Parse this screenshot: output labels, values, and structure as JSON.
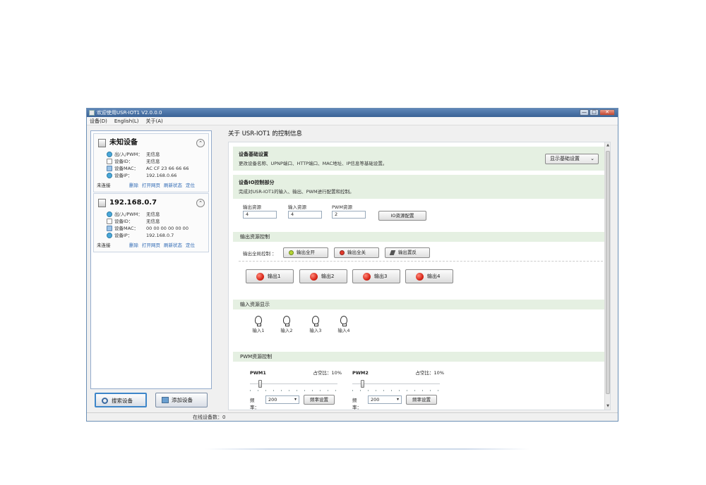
{
  "window": {
    "title": "欢迎使用USR-IOT1 V2.0.0.0",
    "menu": [
      "设备(D)",
      "English(L)",
      "关于(A)"
    ],
    "controls": {
      "minimize": "—",
      "maximize": "□",
      "close": "✕"
    }
  },
  "devices": [
    {
      "name": "未知设备",
      "rows": [
        {
          "key": "出/入/PWM：",
          "value": "无信息"
        },
        {
          "key": "设备ID：",
          "value": "无信息"
        },
        {
          "key": "设备MAC：",
          "value": "AC CF 23 66 66 66"
        },
        {
          "key": "设备IP：",
          "value": "192.168.0.66"
        }
      ],
      "status": "未连接",
      "actions": [
        "删除",
        "打开网页",
        "刷新状态",
        "定位"
      ]
    },
    {
      "name": "192.168.0.7",
      "rows": [
        {
          "key": "出/入/PWM：",
          "value": "无信息"
        },
        {
          "key": "设备ID：",
          "value": "无信息"
        },
        {
          "key": "设备MAC：",
          "value": "00 00 00 00 00 00"
        },
        {
          "key": "设备IP：",
          "value": "192.168.0.7"
        }
      ],
      "status": "未连接",
      "actions": [
        "删除",
        "打开网页",
        "刷新状态",
        "定位"
      ]
    }
  ],
  "left_buttons": {
    "search": "搜索设备",
    "add": "添加设备"
  },
  "statusbar": {
    "text": "在线设备数：0"
  },
  "right": {
    "title": "关于 USR-IOT1 的控制信息",
    "basic": {
      "title": "设备基础设置",
      "desc": "更改设备名称、UPNP端口、HTTP端口、MAC地址、IP信息等基础设置。",
      "dropdown": "显示基础设置",
      "caret": "⌄"
    },
    "io": {
      "title": "设备IO控制部分",
      "desc": "完成对USR-IOT1的输入、输出、PWM进行配置和控制。",
      "fields": [
        {
          "label": "输出资源",
          "value": "4"
        },
        {
          "label": "输入资源",
          "value": "4"
        },
        {
          "label": "PWM资源",
          "value": "2"
        }
      ],
      "config_button": "IO资源配置"
    },
    "output_section": {
      "title": "输出资源控制",
      "global_label": "输出全局控制 ：",
      "all_on": "输出全开",
      "all_off": "输出全关",
      "flip": "输出置反",
      "outputs": [
        "输出1",
        "输出2",
        "输出3",
        "输出4"
      ]
    },
    "input_section": {
      "title": "输入资源显示",
      "inputs": [
        "输入1",
        "输入2",
        "输入3",
        "输入4"
      ]
    },
    "pwm_section": {
      "title": "PWM资源控制",
      "pwms": [
        {
          "name": "PWM1",
          "duty": "占空比：10%",
          "duty_value": 0.1,
          "freq_label": "频率：",
          "freq_value": "200",
          "freq_button": "频率设置"
        },
        {
          "name": "PWM2",
          "duty": "占空比：10%",
          "duty_value": 0.1,
          "freq_label": "频率：",
          "freq_value": "200",
          "freq_button": "频率设置"
        }
      ],
      "caret": "▾"
    },
    "scroll": {
      "up": "▲",
      "down": "▼"
    }
  }
}
